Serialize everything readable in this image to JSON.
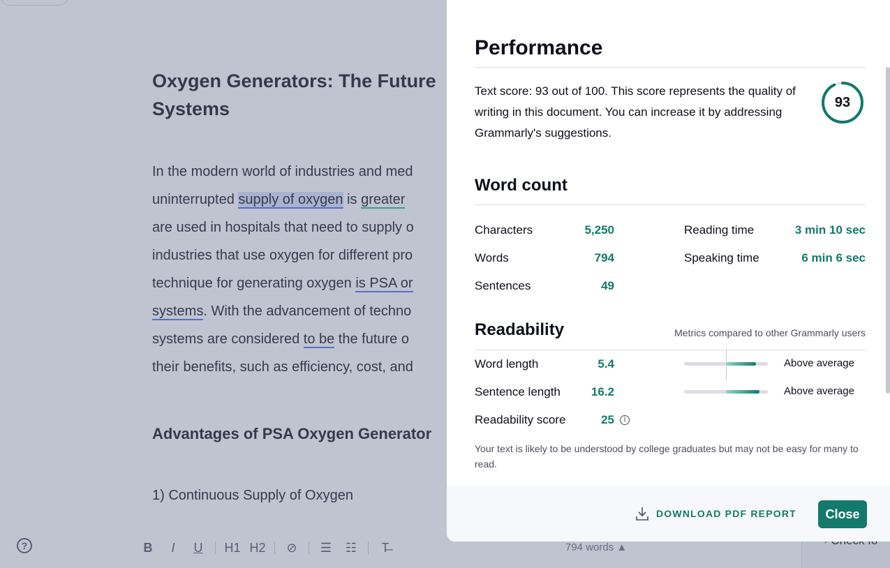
{
  "editor": {
    "title_lines": [
      "Oxygen Generators: The Future",
      "Systems"
    ],
    "paragraph": {
      "l1": "In the modern world of industries and med",
      "l2a": "uninterrupted ",
      "l2b": "supply of oxygen",
      "l2c": " is ",
      "l2d": "greater",
      "l3": "are used in hospitals that need to supply o",
      "l4": "industries that use oxygen for different pro",
      "l5a": "technique for generating oxygen ",
      "l5b": "is PSA or",
      "l6a": "systems",
      "l6b": ". With the advancement of techno",
      "l7a": "systems are considered ",
      "l7b": "to be",
      "l7c": " the future o",
      "l8": "their benefits, such as efficiency, cost, and"
    },
    "heading2": "Advantages of PSA Oxygen Generator",
    "list_item": "1) Continuous Supply of Oxygen",
    "toolbar": {
      "bold": "B",
      "italic": "I",
      "underline": "U",
      "h1": "H1",
      "h2": "H2",
      "link": "⊘",
      "ol": "☰",
      "ul": "☷",
      "clear": "T̶"
    },
    "word_count": "794 words ▲",
    "help": "?",
    "side_check": "Check fo"
  },
  "modal": {
    "performance": {
      "title": "Performance",
      "text": "Text score: 93 out of 100. This score represents the quality of writing in this document. You can increase it by addressing Grammarly's suggestions.",
      "score": "93",
      "score_value": 93,
      "accent": "#13796b"
    },
    "word_count": {
      "title": "Word count",
      "characters_label": "Characters",
      "characters_value": "5,250",
      "words_label": "Words",
      "words_value": "794",
      "sentences_label": "Sentences",
      "sentences_value": "49",
      "reading_label": "Reading time",
      "reading_value": "3 min 10 sec",
      "speaking_label": "Speaking time",
      "speaking_value": "6 min 6 sec"
    },
    "readability": {
      "title": "Readability",
      "note": "Metrics compared to other Grammarly users",
      "word_length_label": "Word length",
      "word_length_value": "5.4",
      "word_length_rating": "Above average",
      "sentence_length_label": "Sentence length",
      "sentence_length_value": "16.2",
      "sentence_length_rating": "Above average",
      "score_label": "Readability score",
      "score_value": "25",
      "info_icon": "i",
      "description": "Your text is likely to be understood by college graduates but may not be easy for many to read."
    },
    "footer": {
      "download_label": "DOWNLOAD PDF REPORT",
      "close_label": "Close"
    }
  }
}
